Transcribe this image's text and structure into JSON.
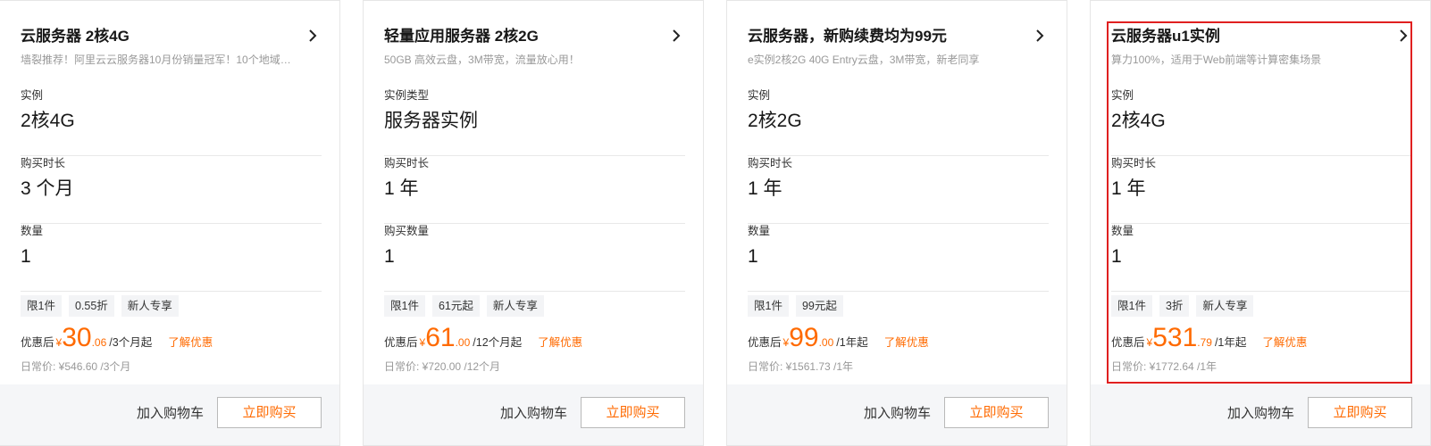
{
  "cards": [
    {
      "title": "云服务器 2核4G",
      "subtitle": "墙裂推荐！阿里云云服务器10月份销量冠军！10个地域…",
      "fields": [
        {
          "label": "实例",
          "value": "2核4G"
        },
        {
          "label": "购买时长",
          "value": "3 个月"
        },
        {
          "label": "数量",
          "value": "1"
        }
      ],
      "tags": [
        "限1件",
        "0.55折",
        "新人专享"
      ],
      "price_label": "优惠后",
      "currency": "¥",
      "price_int": "30",
      "price_dec": ".06",
      "price_unit": "/3个月起",
      "learn_more": "了解优惠",
      "original_price": "日常价: ¥546.60 /3个月",
      "add_to_cart": "加入购物车",
      "buy_now": "立即购买"
    },
    {
      "title": "轻量应用服务器 2核2G",
      "subtitle": "50GB 高效云盘，3M带宽，流量放心用！",
      "fields": [
        {
          "label": "实例类型",
          "value": "服务器实例"
        },
        {
          "label": "购买时长",
          "value": "1 年"
        },
        {
          "label": "购买数量",
          "value": "1"
        }
      ],
      "tags": [
        "限1件",
        "61元起",
        "新人专享"
      ],
      "price_label": "优惠后",
      "currency": "¥",
      "price_int": "61",
      "price_dec": ".00",
      "price_unit": "/12个月起",
      "learn_more": "了解优惠",
      "original_price": "日常价: ¥720.00 /12个月",
      "add_to_cart": "加入购物车",
      "buy_now": "立即购买"
    },
    {
      "title": "云服务器，新购续费均为99元",
      "subtitle": "e实例2核2G 40G Entry云盘，3M带宽，新老同享",
      "fields": [
        {
          "label": "实例",
          "value": "2核2G"
        },
        {
          "label": "购买时长",
          "value": "1 年"
        },
        {
          "label": "数量",
          "value": "1"
        }
      ],
      "tags": [
        "限1件",
        "99元起"
      ],
      "price_label": "优惠后",
      "currency": "¥",
      "price_int": "99",
      "price_dec": ".00",
      "price_unit": "/1年起",
      "learn_more": "了解优惠",
      "original_price": "日常价: ¥1561.73 /1年",
      "add_to_cart": "加入购物车",
      "buy_now": "立即购买"
    },
    {
      "title": "云服务器u1实例",
      "subtitle": "算力100%，适用于Web前端等计算密集场景",
      "fields": [
        {
          "label": "实例",
          "value": "2核4G"
        },
        {
          "label": "购买时长",
          "value": "1 年"
        },
        {
          "label": "数量",
          "value": "1"
        }
      ],
      "tags": [
        "限1件",
        "3折",
        "新人专享"
      ],
      "price_label": "优惠后",
      "currency": "¥",
      "price_int": "531",
      "price_dec": ".79",
      "price_unit": "/1年起",
      "learn_more": "了解优惠",
      "original_price": "日常价: ¥1772.64 /1年",
      "add_to_cart": "加入购物车",
      "buy_now": "立即购买"
    }
  ],
  "colors": {
    "accent": "#ff6a00",
    "highlight_border": "#e02020",
    "footer_bg": "#f5f6f8",
    "tag_bg": "#f3f4f6"
  },
  "icons": {
    "title_arrow": "chevron-right-icon"
  }
}
